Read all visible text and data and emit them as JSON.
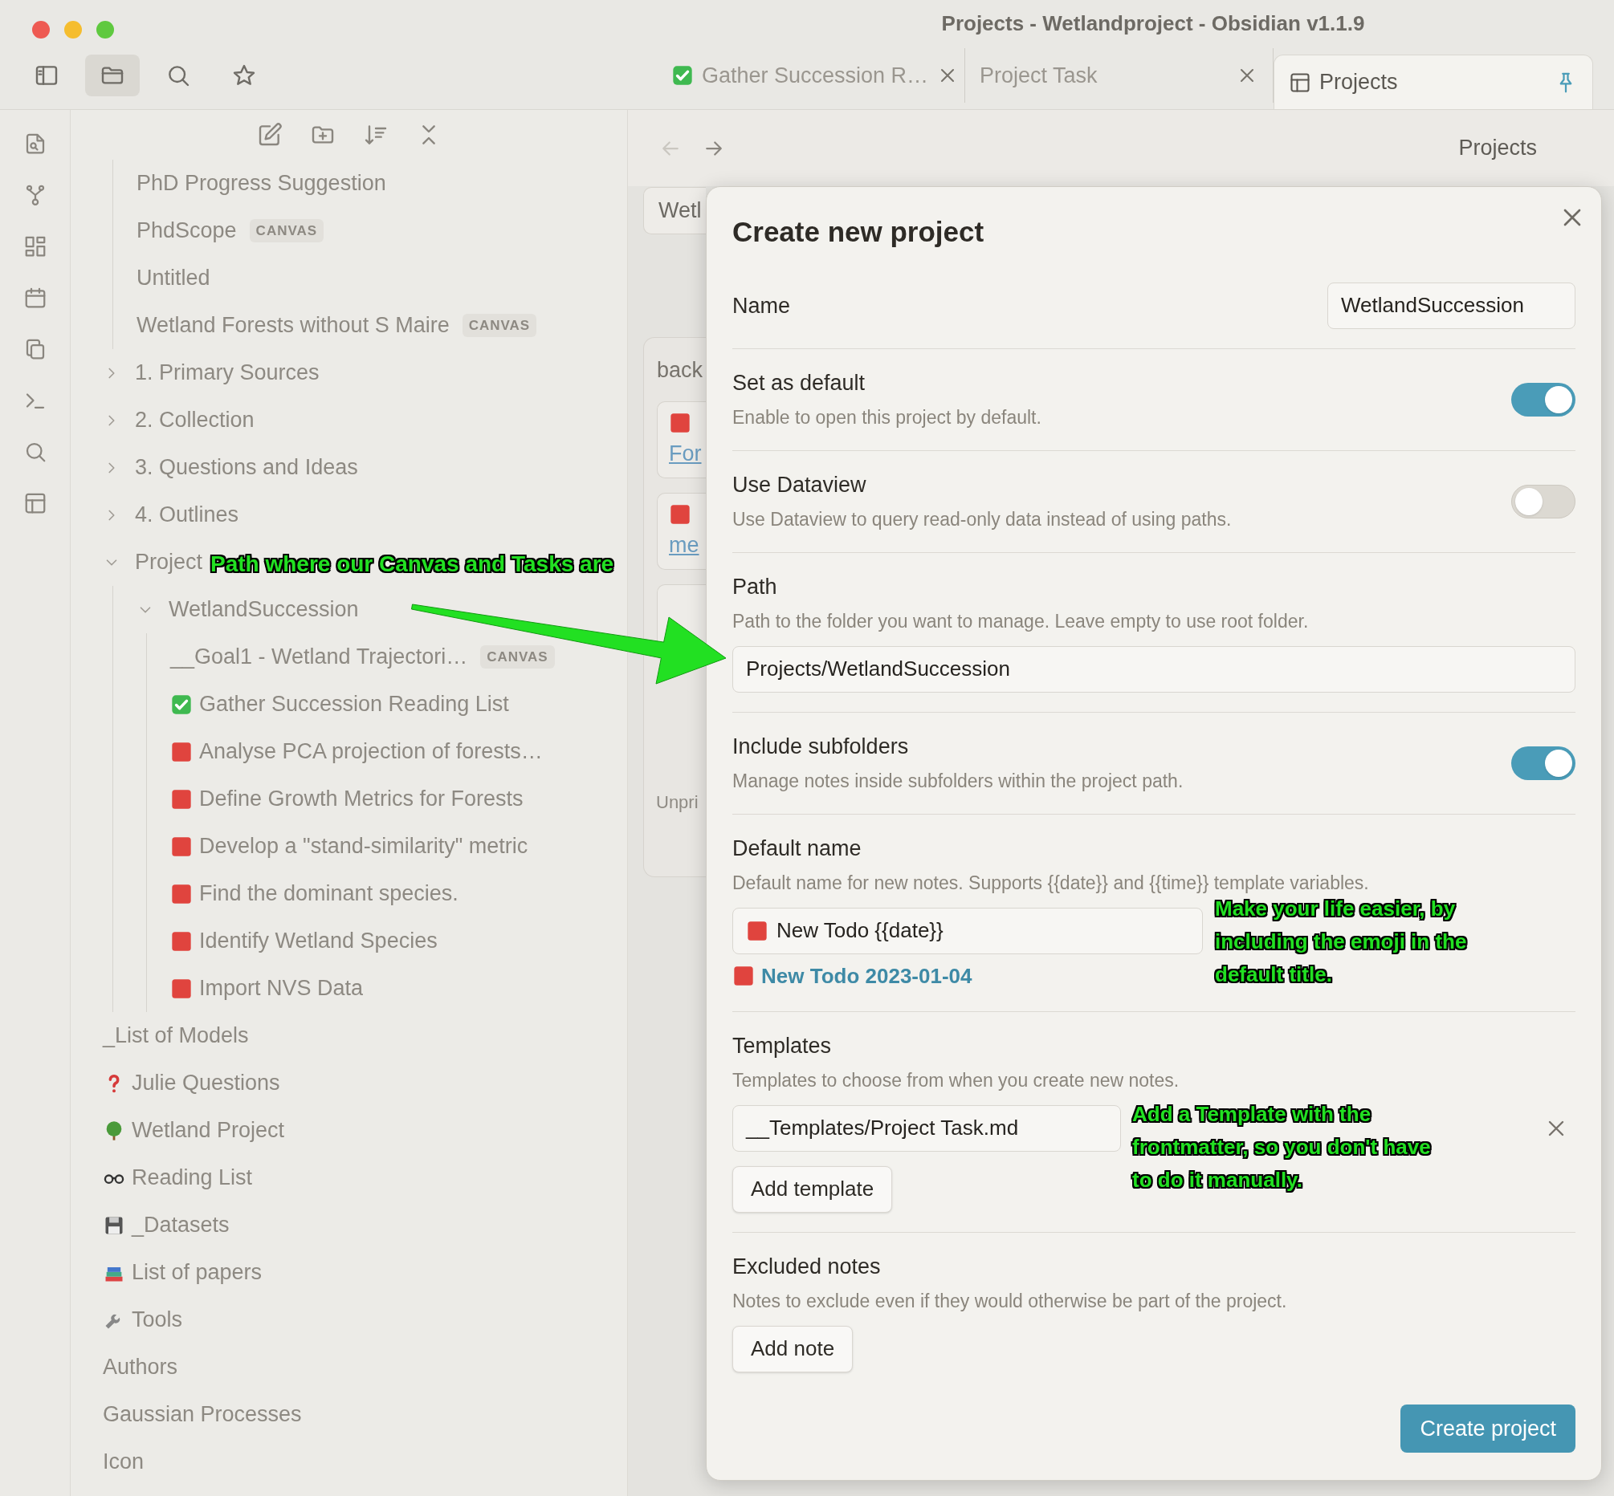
{
  "window": {
    "title": "Projects - Wetlandproject - Obsidian v1.1.9"
  },
  "sidebar_toolbar": [
    {
      "kind": "sidebar",
      "selected": false
    },
    {
      "kind": "files",
      "selected": true
    },
    {
      "kind": "search",
      "selected": false
    },
    {
      "kind": "bookmarks",
      "selected": false
    }
  ],
  "tabs": [
    {
      "label": "Gather Succession R…",
      "kind": "done",
      "selected": false
    },
    {
      "label": "Project Task",
      "kind": "note",
      "selected": false
    },
    {
      "label": "Projects",
      "kind": "view",
      "selected": true
    }
  ],
  "file_tree": [
    {
      "children": [
        {
          "label": "PhD Progress Suggestion",
          "kind": "note"
        },
        {
          "label": "PhdScope",
          "kind": "note",
          "badge": "CANVAS"
        },
        {
          "label": "Untitled",
          "kind": "note"
        },
        {
          "label": "Wetland Forests without S Maire",
          "kind": "note",
          "badge": "CANVAS"
        }
      ]
    },
    {
      "label": "1. Primary Sources",
      "kind": "folder",
      "expanded": false
    },
    {
      "label": "2. Collection",
      "kind": "folder",
      "expanded": false
    },
    {
      "label": "3. Questions and Ideas",
      "kind": "folder",
      "expanded": false
    },
    {
      "label": "4. Outlines",
      "kind": "folder",
      "expanded": false
    },
    {
      "label": "Project",
      "kind": "folder",
      "expanded": true,
      "children": [
        {
          "label": "WetlandSuccession",
          "kind": "folder",
          "expanded": true,
          "children": [
            {
              "label": "__Goal1 - Wetland Trajectori…",
              "kind": "note",
              "badge": "CANVAS"
            },
            {
              "label": "Gather Succession Reading List",
              "kind": "done"
            },
            {
              "label": "Analyse PCA projection of forests…",
              "kind": "todo"
            },
            {
              "label": "Define Growth Metrics for Forests",
              "kind": "todo"
            },
            {
              "label": "Develop a \"stand-similarity\" metric",
              "kind": "todo"
            },
            {
              "label": "Find the dominant species.",
              "kind": "todo"
            },
            {
              "label": "Identify Wetland Species",
              "kind": "todo"
            },
            {
              "label": "Import NVS Data",
              "kind": "todo"
            }
          ]
        }
      ]
    },
    {
      "label": "_List of Models",
      "kind": "note"
    },
    {
      "label": "Julie Questions",
      "kind": "question"
    },
    {
      "label": "Wetland Project",
      "kind": "tree"
    },
    {
      "label": "Reading List",
      "kind": "glasses"
    },
    {
      "label": "_Datasets",
      "kind": "disk"
    },
    {
      "label": "List of papers",
      "kind": "books"
    },
    {
      "label": "Tools",
      "kind": "wrench"
    },
    {
      "label": "Authors",
      "kind": "note"
    },
    {
      "label": "Gaussian Processes",
      "kind": "note"
    },
    {
      "label": "Icon",
      "kind": "note"
    }
  ],
  "main": {
    "nav_buttons": [
      {
        "kind": "back",
        "disabled": true
      },
      {
        "kind": "forward",
        "disabled": false
      }
    ],
    "header_title": "Projects",
    "view_tab": "Wetl",
    "board_title": "back",
    "cards": [
      {
        "kind": "todo",
        "link": "For"
      },
      {
        "kind": "todo",
        "link": "me"
      },
      {
        "kind": "blank"
      }
    ],
    "footer": "Unpri"
  },
  "modal": {
    "title": "Create new project",
    "sections": [
      {
        "kind": "name_input",
        "label": "Name",
        "value": "WetlandSuccession"
      },
      {
        "kind": "toggle",
        "label": "Set as default",
        "description": "Enable to open this project by default.",
        "on": true
      },
      {
        "kind": "toggle",
        "label": "Use Dataview",
        "description": "Use Dataview to query read-only data instead of using paths.",
        "on": false
      },
      {
        "kind": "path_input",
        "label": "Path",
        "description": "Path to the folder you want to manage. Leave empty to use root folder.",
        "value": "Projects/WetlandSuccession"
      },
      {
        "kind": "toggle",
        "label": "Include subfolders",
        "description": "Manage notes inside subfolders within the project path.",
        "on": true
      },
      {
        "kind": "default_name",
        "label": "Default name",
        "description": "Default name for new notes. Supports {{date}} and {{time}} template variables.",
        "value": "New Todo {{date}}",
        "preview": "New Todo 2023-01-04"
      },
      {
        "kind": "templates",
        "label": "Templates",
        "description": "Templates to choose from when you create new notes.",
        "items": [
          "__Templates/Project Task.md"
        ],
        "button": "Add template"
      },
      {
        "kind": "excluded",
        "label": "Excluded notes",
        "description": "Notes to exclude even if they would otherwise be part of the project.",
        "button": "Add note"
      }
    ],
    "submit": "Create project"
  },
  "annotations": [
    "Path where our Canvas and Tasks are",
    "Make your life easier, by including the emoji in the default title.",
    "Add a Template with the frontmatter, so you don't have to do it manually."
  ]
}
